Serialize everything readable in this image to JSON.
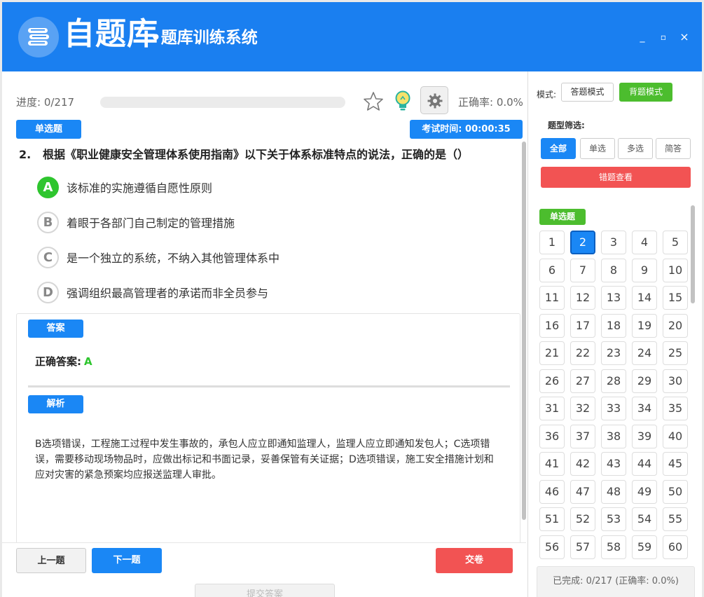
{
  "header": {
    "app_name": "自题库",
    "subtitle": "•题库训练系统",
    "brand_color": "#1a7ff0",
    "icons": [
      "book-stack-icon",
      "minimize-icon",
      "maximize-icon",
      "close-icon"
    ],
    "minimize": "_",
    "maximize": "▫",
    "close": "×"
  },
  "toolbar": {
    "progress_label": "进度: 0/217",
    "progress_fraction": 0,
    "accuracy_label": "正确率: 0.0%",
    "icons": [
      "star-icon",
      "lightbulb-icon",
      "gear-icon"
    ]
  },
  "question": {
    "type_tag": "单选题",
    "timer": "考试时间: 00:00:35",
    "number": "2.",
    "text": "根据《职业健康安全管理体系使用指南》以下关于体系标准特点的说法，正确的是（）",
    "options": [
      {
        "letter": "A",
        "text": "该标准的实施遵循自愿性原则",
        "correct": true
      },
      {
        "letter": "B",
        "text": "着眼于各部门自己制定的管理措施",
        "correct": false
      },
      {
        "letter": "C",
        "text": "是一个独立的系统，不纳入其他管理体系中",
        "correct": false
      },
      {
        "letter": "D",
        "text": "强调组织最高管理者的承诺而非全员参与",
        "correct": false
      }
    ]
  },
  "answer": {
    "tag": "答案",
    "label": "正确答案:",
    "value": "A",
    "explain_tag": "解析",
    "explanation": "B选项错误，工程施工过程中发生事故的，承包人应立即通知监理人，监理人应立即通知发包人；C选项错误，需要移动现场物品时，应做出标记和书面记录，妥善保管有关证据；D选项错误，施工安全措施计划和应对灾害的紧急预案均应报送监理人审批。"
  },
  "nav": {
    "prev": "上一题",
    "next": "下一题",
    "submit_exam": "交卷",
    "submit_answer": "提交答案"
  },
  "sidebar": {
    "mode_label": "模式:",
    "mode_answer": "答题模式",
    "mode_recite": "背题模式",
    "filter_label": "题型筛选:",
    "filters": [
      "全部",
      "单选",
      "多选",
      "简答"
    ],
    "wrong_review": "错题查看",
    "section_tag": "单选题",
    "current_question": 2,
    "question_numbers": [
      1,
      2,
      3,
      4,
      5,
      6,
      7,
      8,
      9,
      10,
      11,
      12,
      13,
      14,
      15,
      16,
      17,
      18,
      19,
      20,
      21,
      22,
      23,
      24,
      25,
      26,
      27,
      28,
      29,
      30,
      31,
      32,
      33,
      34,
      35,
      36,
      37,
      38,
      39,
      40,
      41,
      42,
      43,
      44,
      45,
      46,
      47,
      48,
      49,
      50,
      51,
      52,
      53,
      54,
      55,
      56,
      57,
      58,
      59,
      60
    ],
    "completed": "已完成: 0/217 (正确率: 0.0%)"
  }
}
